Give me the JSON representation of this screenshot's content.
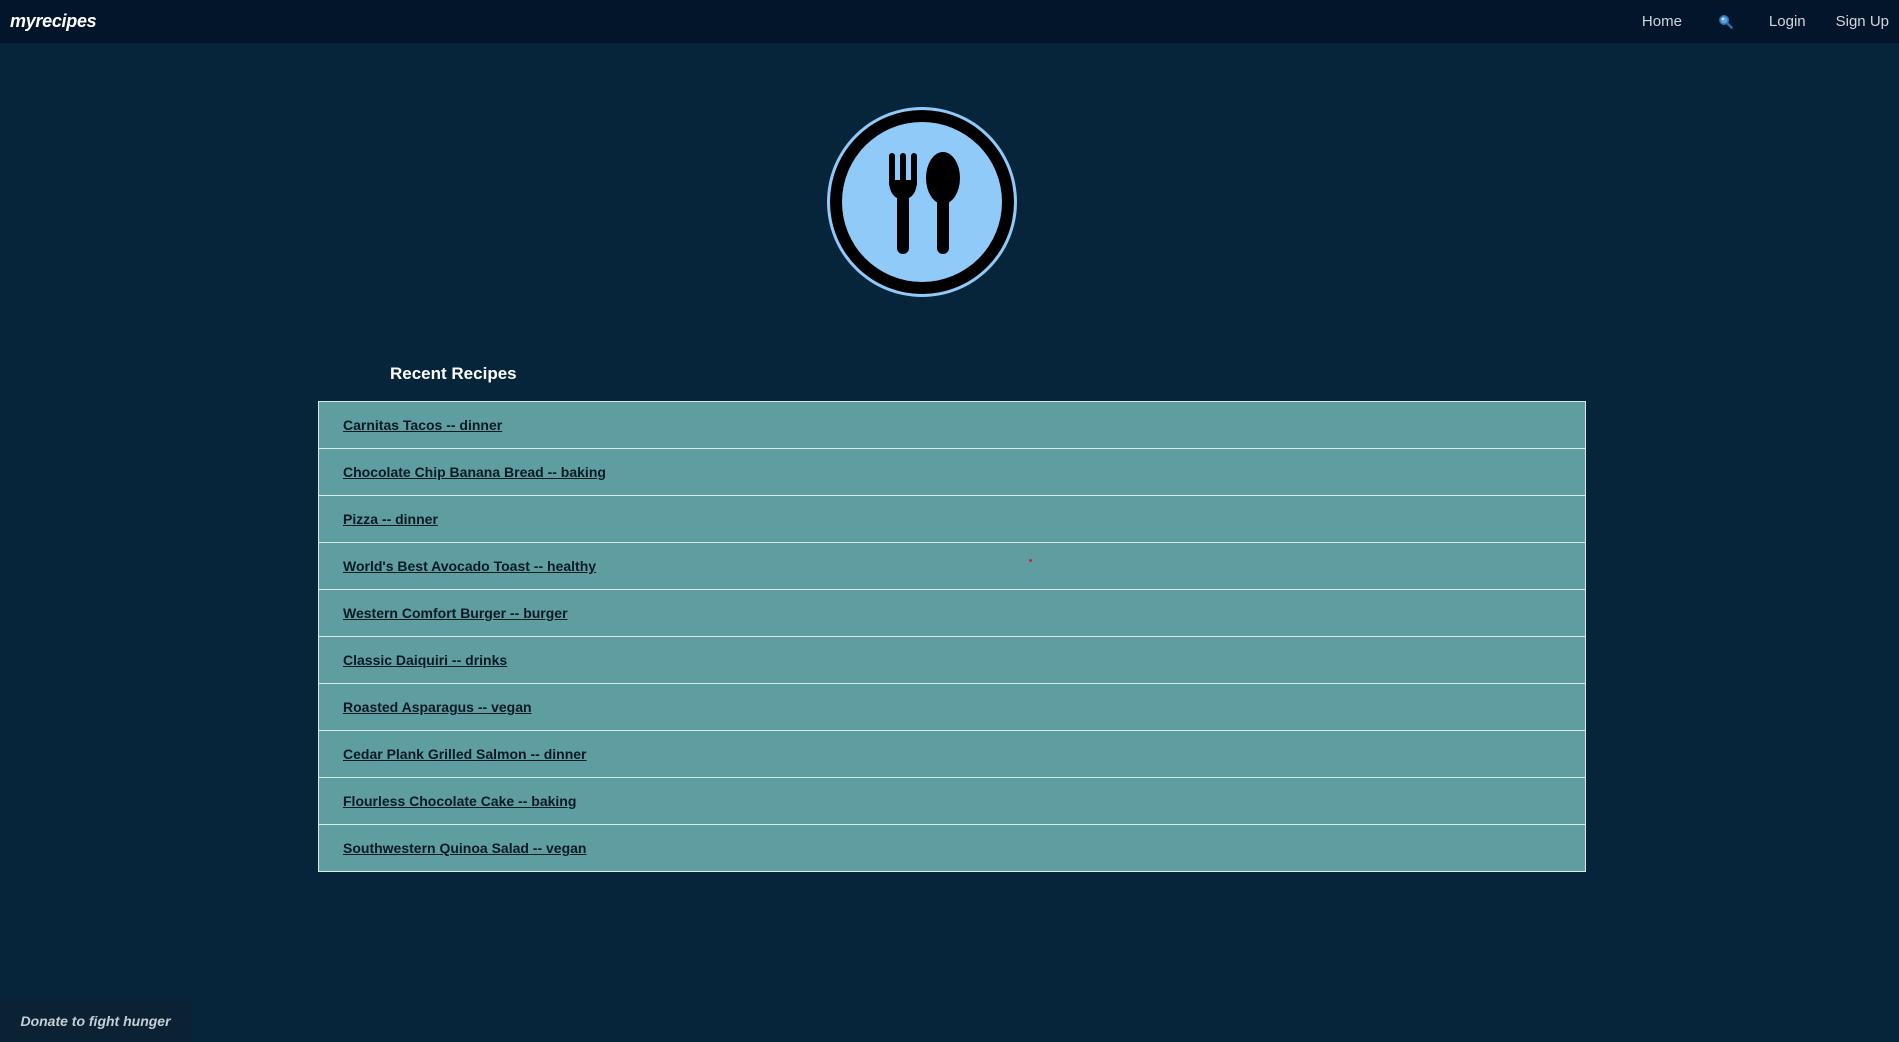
{
  "navbar": {
    "brand": "myrecipes",
    "links": {
      "home": "Home",
      "search_icon": "search-icon",
      "login": "Login",
      "signup": "Sign Up"
    }
  },
  "logo": {
    "icon": "fork-spoon-icon",
    "colors": {
      "fill": "#8fcaf8",
      "ring": "#000000"
    }
  },
  "recent_recipes": {
    "title": "Recent Recipes",
    "items": [
      {
        "label": "Carnitas Tacos -- dinner"
      },
      {
        "label": "Chocolate Chip Banana Bread -- baking"
      },
      {
        "label": "Pizza -- dinner"
      },
      {
        "label": "World's Best Avocado Toast -- healthy"
      },
      {
        "label": "Western Comfort Burger -- burger"
      },
      {
        "label": "Classic Daiquiri -- drinks"
      },
      {
        "label": "Roasted Asparagus -- vegan"
      },
      {
        "label": "Cedar Plank Grilled Salmon -- dinner"
      },
      {
        "label": "Flourless Chocolate Cake -- baking"
      },
      {
        "label": "Southwestern Quinoa Salad -- vegan"
      }
    ]
  },
  "footer": {
    "donate": "Donate to fight hunger"
  },
  "colors": {
    "page_bg": "#06253a",
    "navbar_bg": "#03152a",
    "list_item_bg": "#5f9ea0"
  }
}
